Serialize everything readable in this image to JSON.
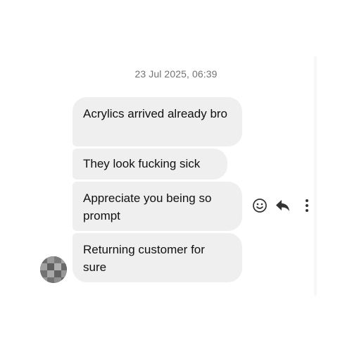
{
  "conversation": {
    "timestamp": "23 Jul 2025, 06:39",
    "messages": [
      {
        "text": "Acrylics arrived already bro"
      },
      {
        "text": "They look fucking sick"
      },
      {
        "text": "Appreciate you being so prompt"
      },
      {
        "text": "Returning customer for sure"
      }
    ]
  },
  "message_actions": {
    "icons": [
      "emoji-icon",
      "reply-icon",
      "more-options-icon"
    ]
  },
  "colors": {
    "bubble_background": "#efefef",
    "text": "#111111",
    "timestamp_text": "#737373",
    "icon": "#333333"
  }
}
